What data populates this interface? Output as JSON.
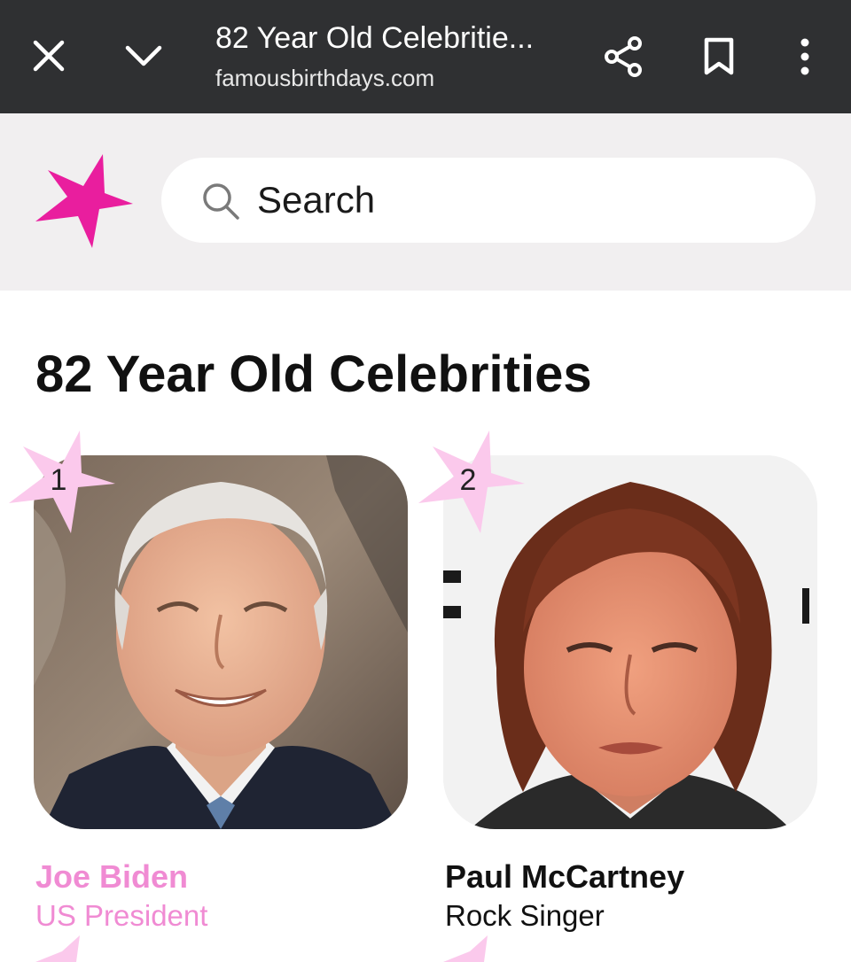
{
  "browser": {
    "title": "82 Year Old Celebritie...",
    "url": "famousbirthdays.com",
    "icons": [
      "close-icon",
      "chevron-down-icon",
      "share-icon",
      "bookmark-icon",
      "more-vert-icon"
    ]
  },
  "header": {
    "logo_color": "#e91e9e",
    "search_placeholder": "Search"
  },
  "main": {
    "title": "82 Year Old Celebrities",
    "celebrities": [
      {
        "rank": "1",
        "name": "Joe Biden",
        "profession": "US President",
        "highlighted": true
      },
      {
        "rank": "2",
        "name": "Paul McCartney",
        "profession": "Rock Singer",
        "highlighted": false
      }
    ]
  },
  "colors": {
    "topbar": "#2f3032",
    "header_bg": "#f1eff0",
    "accent_pink": "#e91e9e",
    "rank_star": "#fbc9ec",
    "highlight_text": "#f08bd3"
  }
}
